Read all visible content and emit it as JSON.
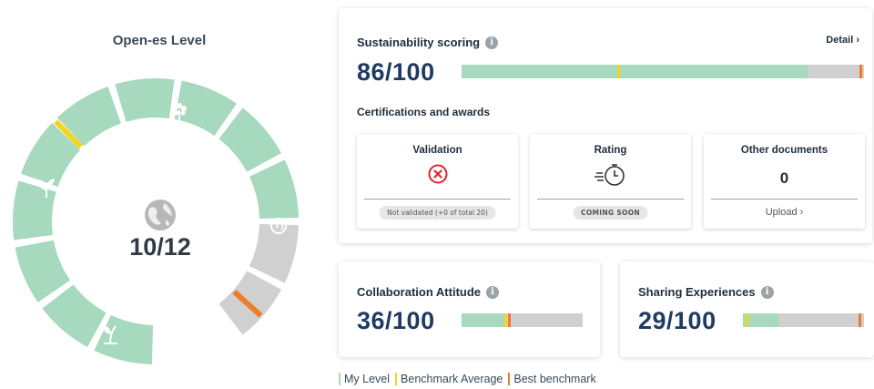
{
  "level": {
    "title": "Open-es Level",
    "value": "10/12",
    "current": 10,
    "total": 12,
    "segment_colors": {
      "achieved": "#a6d9bd",
      "pending": "#cfd0cf"
    },
    "benchmark_color": "#f5d322",
    "best_color": "#ef7c2a"
  },
  "sustainability": {
    "title": "Sustainability scoring",
    "detail_label": "Detail",
    "score": "86/100",
    "value": 86,
    "benchmark": 39,
    "best": 99,
    "certifications_title": "Certifications and awards",
    "validation": {
      "title": "Validation",
      "status": "Not validated (+0 of total 20)"
    },
    "rating": {
      "title": "Rating",
      "status": "COMING SOON"
    },
    "other_documents": {
      "title": "Other documents",
      "count": "0",
      "upload_label": "Upload"
    }
  },
  "collaboration": {
    "title": "Collaboration Attitude",
    "score": "36/100",
    "value": 36,
    "benchmark": 36,
    "best": 39
  },
  "sharing": {
    "title": "Sharing Experiences",
    "score": "29/100",
    "value": 29,
    "benchmark": 3,
    "best": 96
  },
  "legend": {
    "my_level": "My Level",
    "benchmark_average": "Benchmark Average",
    "best_benchmark": "Best benchmark"
  },
  "colors": {
    "score_text": "#1f3b63",
    "my_level": "#a6d9bd",
    "benchmark": "#f5d322",
    "best": "#ef7c2a",
    "bar_track": "#cfd0cf"
  }
}
